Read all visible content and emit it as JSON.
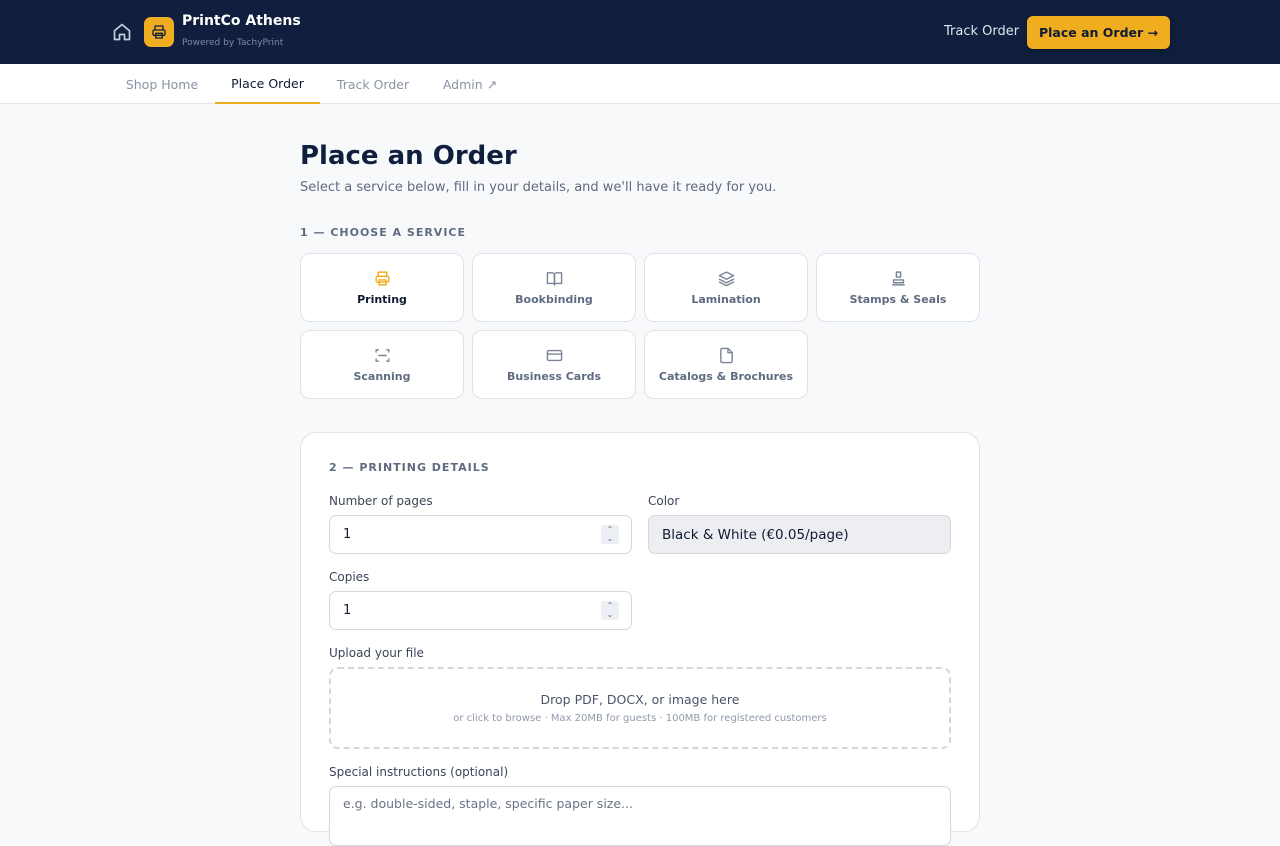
{
  "header": {
    "brand_name": "PrintCo Athens",
    "brand_sub": "Powered by TachyPrint",
    "track_link": "Track Order",
    "cta_label": "Place an Order →"
  },
  "tabs": [
    {
      "label": "Shop Home",
      "active": false
    },
    {
      "label": "Place Order",
      "active": true
    },
    {
      "label": "Track Order",
      "active": false
    },
    {
      "label": "Admin ↗",
      "active": false
    }
  ],
  "page": {
    "title": "Place an Order",
    "subtitle": "Select a service below, fill in your details, and we'll have it ready for you."
  },
  "services_section": {
    "label": "1 — CHOOSE A SERVICE",
    "items": [
      {
        "label": "Printing",
        "icon": "printer-icon",
        "selected": true
      },
      {
        "label": "Bookbinding",
        "icon": "book-icon",
        "selected": false
      },
      {
        "label": "Lamination",
        "icon": "layers-icon",
        "selected": false
      },
      {
        "label": "Stamps & Seals",
        "icon": "stamp-icon",
        "selected": false
      },
      {
        "label": "Scanning",
        "icon": "scan-icon",
        "selected": false
      },
      {
        "label": "Business Cards",
        "icon": "card-icon",
        "selected": false
      },
      {
        "label": "Catalogs & Brochures",
        "icon": "document-icon",
        "selected": false
      }
    ]
  },
  "details": {
    "section_label": "2 — PRINTING DETAILS",
    "pages_label": "Number of pages",
    "pages_value": "1",
    "color_label": "Color",
    "color_value": "Black & White (€0.05/page)",
    "copies_label": "Copies",
    "copies_value": "1",
    "upload_label": "Upload your file",
    "upload_main": "Drop PDF, DOCX, or image here",
    "upload_sub": "or click to browse · Max 20MB for guests · 100MB for registered customers",
    "instructions_label": "Special instructions (optional)",
    "instructions_placeholder": "e.g. double-sided, staple, specific paper size..."
  },
  "colors": {
    "navy": "#0f1f3d",
    "accent": "#f0ad1f"
  }
}
